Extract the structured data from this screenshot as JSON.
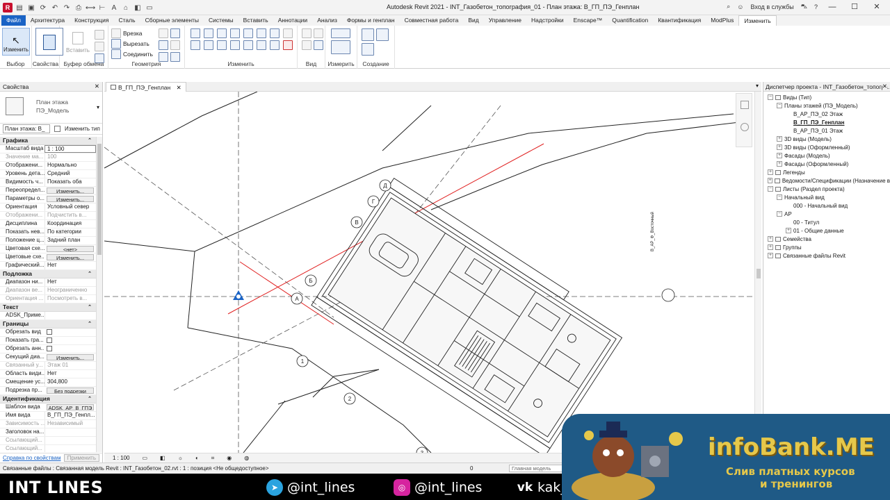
{
  "titlebar": {
    "title": "Autodesk Revit 2021 - INT_Газобетон_топография_01 - План этажа: В_ГП_ПЭ_Генплан",
    "signin": "Вход в службы",
    "logo": "R"
  },
  "tabs": [
    "Файл",
    "Архитектура",
    "Конструкция",
    "Сталь",
    "Сборные элементы",
    "Системы",
    "Вставить",
    "Аннотации",
    "Анализ",
    "Формы и генплан",
    "Совместная работа",
    "Вид",
    "Управление",
    "Надстройки",
    "Enscape™",
    "Quantification",
    "Квантификация",
    "ModPlus",
    "Изменить"
  ],
  "active_tab": "Изменить",
  "ribbon": {
    "modify_btn": "Изменить",
    "paste_btn": "Вставить",
    "panels": {
      "select": "Выбор",
      "properties": "Свойства",
      "clipboard": "Буфер обмена",
      "geometry": "Геометрия",
      "modify": "Изменить",
      "view": "Вид",
      "measure": "Измерить",
      "create": "Создание"
    },
    "geometry_items": [
      "Врезка",
      "Вырезать",
      "Соединить"
    ]
  },
  "properties": {
    "title": "Свойства",
    "type_line1": "План этажа",
    "type_line2": "ПЭ_Модель",
    "selector": "План этажа: В_",
    "edit_type": "Изменить тип",
    "apply": "Применить",
    "help_link": "Справка по свойствам",
    "groups": [
      {
        "name": "Графика",
        "rows": [
          {
            "k": "Масштаб вида",
            "v": "1 : 100",
            "style": "box"
          },
          {
            "k": "Значение ма...",
            "v": "100",
            "dim": true
          },
          {
            "k": "Отображени...",
            "v": "Нормально"
          },
          {
            "k": "Уровень дета...",
            "v": "Средний"
          },
          {
            "k": "Видимость ч...",
            "v": "Показать оба"
          },
          {
            "k": "Переопредел...",
            "v": "Изменить...",
            "style": "btn"
          },
          {
            "k": "Параметры о...",
            "v": "Изменить...",
            "style": "btn"
          },
          {
            "k": "Ориентация",
            "v": "Условный север"
          },
          {
            "k": "Отображени...",
            "v": "Подчистить в...",
            "dim": true
          },
          {
            "k": "Дисциплина",
            "v": "Координация"
          },
          {
            "k": "Показать нев...",
            "v": "По категории"
          },
          {
            "k": "Положение ц...",
            "v": "Задний план"
          },
          {
            "k": "Цветовая схе...",
            "v": "<нет>",
            "style": "btn"
          },
          {
            "k": "Цветовые схе...",
            "v": "Изменить...",
            "style": "btn"
          },
          {
            "k": "Графический...",
            "v": "Нет"
          }
        ]
      },
      {
        "name": "Подложка",
        "rows": [
          {
            "k": "Диапазон ни...",
            "v": "Нет"
          },
          {
            "k": "Диапазон ве...",
            "v": "Неограниченно",
            "dim": true
          },
          {
            "k": "Ориентация ...",
            "v": "Посмотреть в...",
            "dim": true
          }
        ]
      },
      {
        "name": "Текст",
        "rows": [
          {
            "k": "ADSK_Приме...",
            "v": ""
          }
        ]
      },
      {
        "name": "Границы",
        "rows": [
          {
            "k": "Обрезать вид",
            "v": "",
            "style": "cb"
          },
          {
            "k": "Показать гра...",
            "v": "",
            "style": "cb"
          },
          {
            "k": "Обрезать анн...",
            "v": "",
            "style": "cb"
          },
          {
            "k": "Секущий диа...",
            "v": "Изменить...",
            "style": "btn"
          },
          {
            "k": "Связанный у...",
            "v": "Этаж 01",
            "dim": true
          },
          {
            "k": "Область види...",
            "v": "Нет"
          },
          {
            "k": "Смещение ус...",
            "v": "304,800"
          },
          {
            "k": "Подрезка пр...",
            "v": "Без подрезки",
            "style": "btn"
          }
        ]
      },
      {
        "name": "Идентификация",
        "rows": [
          {
            "k": "Шаблон вида",
            "v": "ADSK_АР_В_ГПЭ",
            "style": "btn"
          },
          {
            "k": "Имя вида",
            "v": "В_ГП_ПЭ_Генпл..."
          },
          {
            "k": "Зависимость ...",
            "v": "Независимый",
            "dim": true
          },
          {
            "k": "Заголовок на...",
            "v": ""
          },
          {
            "k": "Ссылающий...",
            "v": "",
            "dim": true
          },
          {
            "k": "Ссылающий...",
            "v": "",
            "dim": true
          }
        ]
      }
    ]
  },
  "view_tab": "В_ГП_ПЭ_Генплан",
  "view_scale": "1 : 100",
  "canvas": {
    "rotated_label": "В_АР_Ф_Восточный",
    "grid_letters": [
      "Д",
      "Г",
      "В",
      "Б",
      "А"
    ],
    "grid_numbers": [
      "1",
      "2",
      "3"
    ]
  },
  "browser": {
    "title": "Диспетчер проекта - INT_Газобетон_топогра...",
    "nodes": [
      {
        "depth": 0,
        "exp": "−",
        "label": "Виды (Тип)"
      },
      {
        "depth": 1,
        "exp": "−",
        "label": "Планы этажей (ПЭ_Модель)"
      },
      {
        "depth": 2,
        "exp": "",
        "label": "В_АР_ПЭ_02 Этаж"
      },
      {
        "depth": 2,
        "exp": "",
        "label": "В_ГП_ПЭ_Генплан",
        "bold": true
      },
      {
        "depth": 2,
        "exp": "",
        "label": "В_АР_ПЭ_01 Этаж"
      },
      {
        "depth": 1,
        "exp": "+",
        "label": "3D виды (Модель)"
      },
      {
        "depth": 1,
        "exp": "+",
        "label": "3D виды (Оформленный)"
      },
      {
        "depth": 1,
        "exp": "+",
        "label": "Фасады (Модель)"
      },
      {
        "depth": 1,
        "exp": "+",
        "label": "Фасады (Оформленный)"
      },
      {
        "depth": 0,
        "exp": "+",
        "label": "Легенды"
      },
      {
        "depth": 0,
        "exp": "+",
        "label": "Ведомости/Спецификации (Назначение в"
      },
      {
        "depth": 0,
        "exp": "−",
        "label": "Листы (Раздел проекта)"
      },
      {
        "depth": 1,
        "exp": "−",
        "label": "Начальный вид"
      },
      {
        "depth": 2,
        "exp": "",
        "label": "000 - Начальный вид"
      },
      {
        "depth": 1,
        "exp": "−",
        "label": "АР"
      },
      {
        "depth": 2,
        "exp": "",
        "label": "00 - Титул"
      },
      {
        "depth": 2,
        "exp": "+",
        "label": "01 - Общие данные"
      },
      {
        "depth": 0,
        "exp": "+",
        "label": "Семейства"
      },
      {
        "depth": 0,
        "exp": "+",
        "label": "Группы"
      },
      {
        "depth": 0,
        "exp": "+",
        "label": "Связанные файлы Revit"
      }
    ]
  },
  "statusbar": {
    "text": "Связанные файлы : Связанная модель Revit : INT_Газобетон_02.rvt : 1 : позиция <Не общедоступное>",
    "zero": "0",
    "model": "Главная модель"
  },
  "brandbar": {
    "brand": "INT LINES",
    "telegram": "@int_lines",
    "instagram": "@int_lines",
    "vk": "kak_"
  },
  "watermark": {
    "site": "infoBank.ME",
    "line1": "Слив платных курсов",
    "line2": "и тренингов"
  },
  "colors": {
    "file_tab": "#1a63c5",
    "accent_line": "#e02020",
    "watermark_bg": "#1f5a86",
    "watermark_text": "#e6c84a"
  }
}
